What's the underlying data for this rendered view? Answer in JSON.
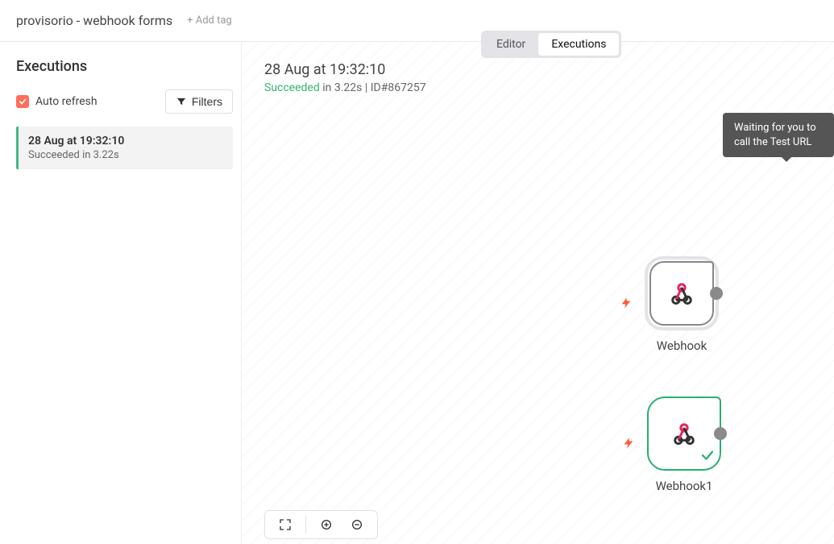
{
  "header": {
    "title": "provisorio - webhook forms",
    "add_tag": "+ Add tag"
  },
  "tabs": {
    "editor": "Editor",
    "executions": "Executions",
    "active": "Executions"
  },
  "sidebar": {
    "title": "Executions",
    "auto_refresh_label": "Auto refresh",
    "auto_refresh_checked": true,
    "filters_label": "Filters",
    "items": [
      {
        "timestamp": "28 Aug at 19:32:10",
        "status": "Succeeded in 3.22s"
      }
    ]
  },
  "summary": {
    "timestamp": "28 Aug at 19:32:10",
    "status_word": "Succeeded",
    "duration": " in 3.22s",
    "id_label": "ID#867257"
  },
  "tooltip": "Waiting for you to call the Test URL",
  "nodes": [
    {
      "label": "Webhook"
    },
    {
      "label": "Webhook1"
    }
  ],
  "icons": {
    "filter": "filter-icon",
    "bolt": "bolt-icon",
    "webhook": "webhook-icon",
    "check": "check-icon",
    "fit": "fit-icon",
    "zoom_in": "zoom-in-icon",
    "zoom_out": "zoom-out-icon"
  }
}
